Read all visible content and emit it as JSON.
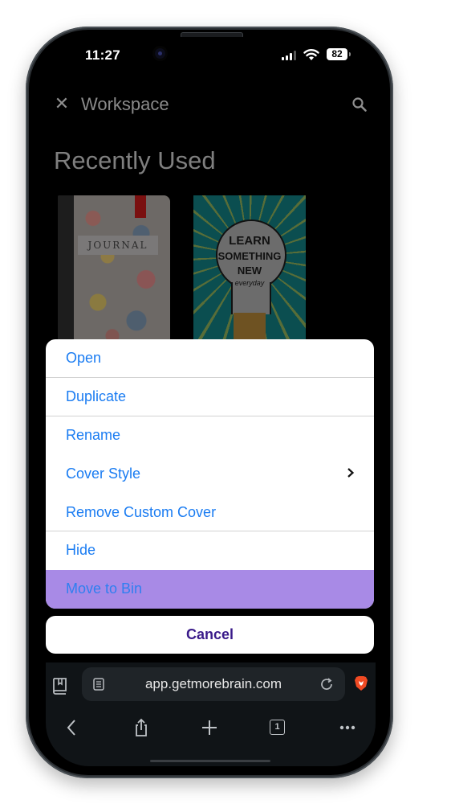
{
  "status_bar": {
    "time": "11:27",
    "battery_level": "82",
    "signal_bars_active": 3,
    "signal_bars_total": 4
  },
  "app": {
    "close_icon": "close-icon",
    "title": "Workspace",
    "search_icon": "search-icon",
    "section_title": "Recently Used",
    "notebooks": [
      {
        "cover_text": "JOURNAL",
        "cover_style": "floral"
      },
      {
        "cover_text_lines": [
          "LEARN",
          "SOMETHING",
          "NEW",
          "everyday"
        ],
        "cover_style": "lightbulb"
      }
    ]
  },
  "action_sheet": {
    "items": [
      {
        "label": "Open"
      },
      {
        "label": "Duplicate"
      },
      {
        "label": "Rename"
      },
      {
        "label": "Cover Style",
        "has_submenu": true
      },
      {
        "label": "Remove Custom Cover"
      },
      {
        "label": "Hide"
      },
      {
        "label": "Move to Bin",
        "highlighted": true
      }
    ],
    "cancel_label": "Cancel",
    "colors": {
      "item_text": "#1a7cf2",
      "highlight_bg": "#a88ae6",
      "cancel_text": "#3a1b8a"
    }
  },
  "browser": {
    "url": "app.getmorebrain.com",
    "tab_count": "1",
    "icons": [
      "bookmarks-icon",
      "reader-mode-icon",
      "reload-icon",
      "brave-shield-icon",
      "back-icon",
      "share-icon",
      "new-tab-icon",
      "tabs-icon",
      "more-icon"
    ]
  }
}
